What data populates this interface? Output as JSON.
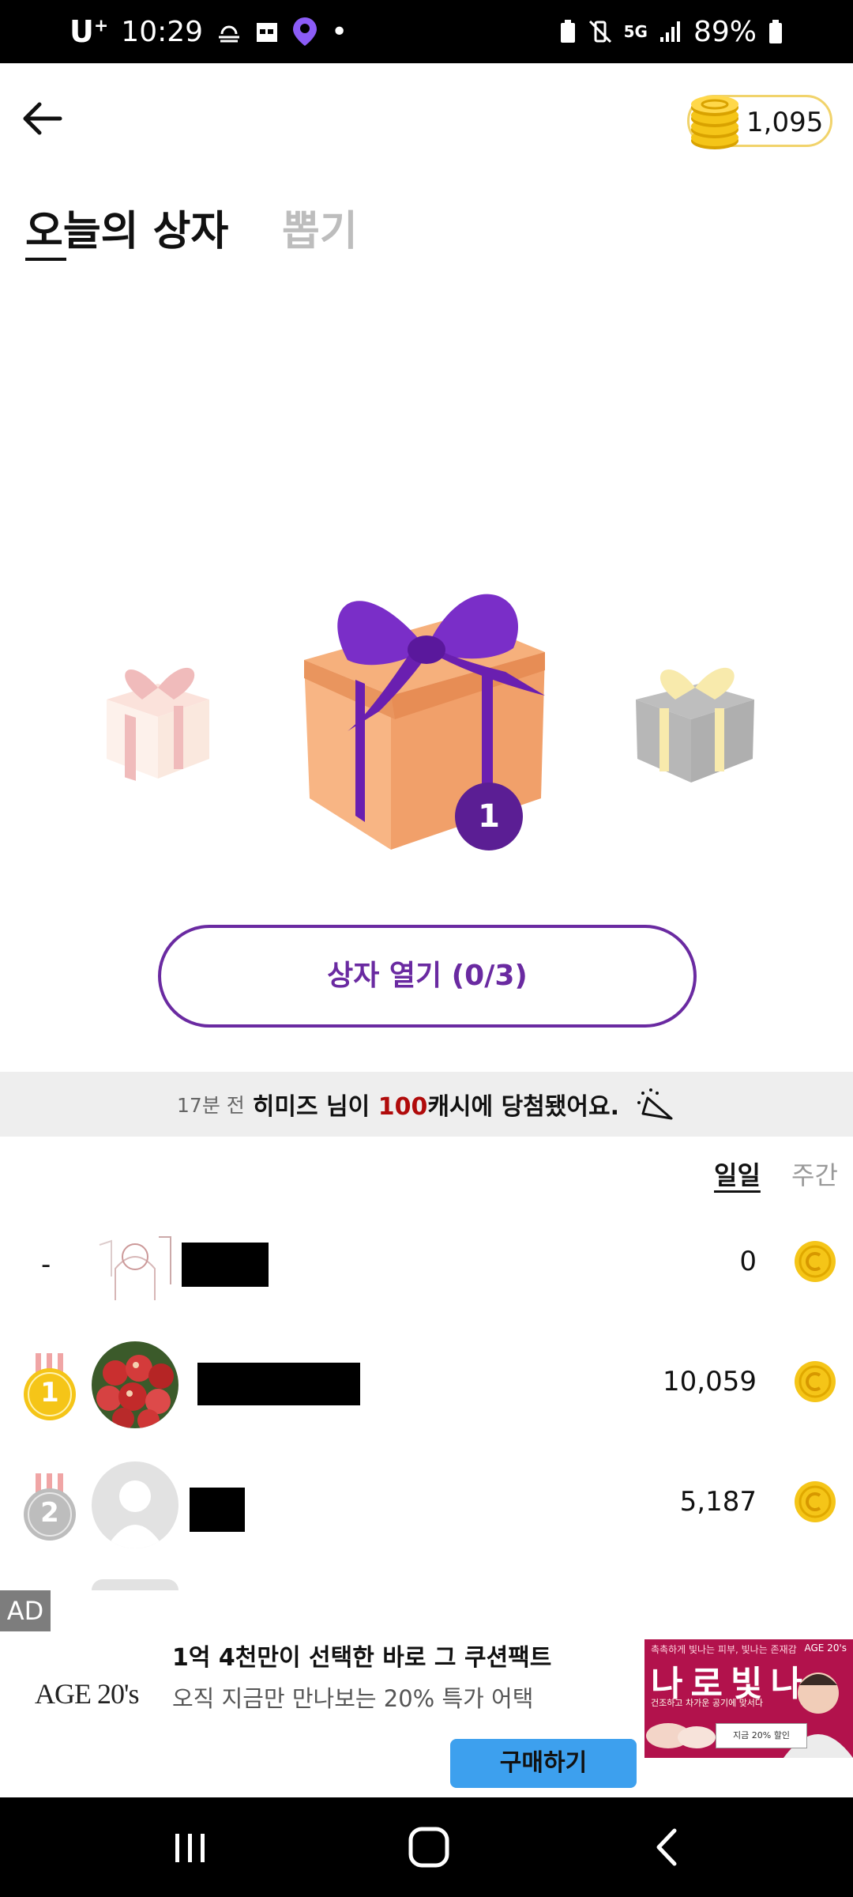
{
  "status_bar": {
    "carrier": "U",
    "carrier_sup": "+",
    "time": "10:29",
    "network": "5G",
    "battery": "89%"
  },
  "header": {
    "coin_balance": "1,095"
  },
  "tabs": {
    "active": "오늘의 상자",
    "inactive": "뽑기"
  },
  "gift": {
    "count_badge": "1",
    "open_button": "상자 열기 (0/3)"
  },
  "ticker": {
    "time_ago": "17분 전",
    "user": "히미즈 님이",
    "amount": "100",
    "suffix": "캐시에 당첨됐어요."
  },
  "period_tabs": {
    "daily": "일일",
    "weekly": "주간"
  },
  "ranking": [
    {
      "rank": "-",
      "score": "0"
    },
    {
      "rank": "1",
      "score": "10,059"
    },
    {
      "rank": "2",
      "score": "5,187"
    }
  ],
  "ad": {
    "tag": "AD",
    "brand": "AGE 20's",
    "title": "1억 4천만이 선택한 바로 그 쿠션팩트",
    "description": "오직 지금만 만나보는 20% 특가 어택",
    "cta": "구매하기",
    "image_top": "촉촉하게 빛나는 피부, 빛나는 존재감",
    "image_age": "AGE 20's",
    "image_headline": "나로빛나",
    "image_sub": "건조하고 차가운 공기에 맞서다",
    "image_badge": "지금 20% 할인"
  },
  "colors": {
    "accent": "#6a2aa1",
    "badge": "#5b1e94",
    "coin": "#f5c518",
    "ticker_highlight": "#b00b0b",
    "cta_blue": "#3da0ee"
  }
}
